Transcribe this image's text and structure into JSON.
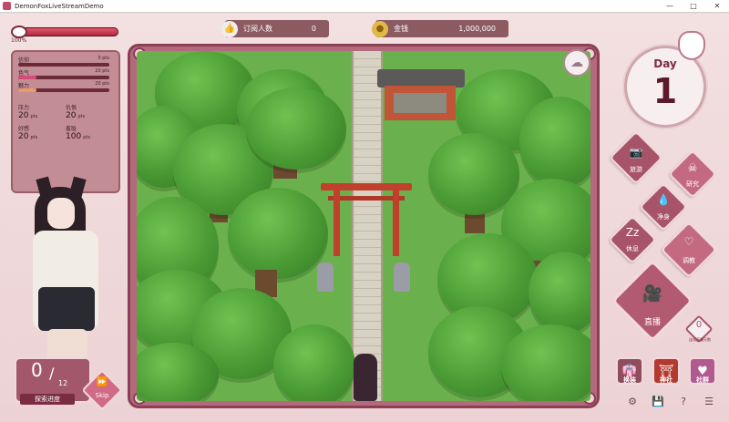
{
  "window": {
    "title": "DemonFoxLiveStreamDemo",
    "minimize_glyph": "—",
    "maximize_glyph": "□",
    "close_glyph": "✕"
  },
  "hud": {
    "hp_label": "100%",
    "hp_fraction": 1.0,
    "subscribers_label": "订阅人数",
    "subscribers_value": "0",
    "gold_label": "金钱",
    "gold_value": "1,000,000"
  },
  "stats": {
    "bars": [
      {
        "name": "信仰",
        "amount": "0",
        "unit": "pts",
        "fraction": 0.0
      },
      {
        "name": "色气",
        "amount": "20",
        "unit": "pts",
        "fraction": 0.2
      },
      {
        "name": "魅力",
        "amount": "20",
        "unit": "pts",
        "fraction": 0.2
      }
    ],
    "cells": [
      {
        "name": "压力",
        "value": "20",
        "unit": "pts"
      },
      {
        "name": "仇恨",
        "value": "20",
        "unit": "pts"
      },
      {
        "name": "好感",
        "value": "20",
        "unit": "pts"
      },
      {
        "name": "羞耻",
        "value": "100",
        "unit": "pts"
      }
    ]
  },
  "exploration": {
    "current": "0",
    "separator": "/",
    "total": "12",
    "label": "探索进度",
    "skip_label": "Skip",
    "skip_icon": "⏩"
  },
  "day": {
    "label": "Day",
    "number": "1"
  },
  "actions": [
    {
      "id": "travel",
      "label": "旅游",
      "icon": "camera-icon",
      "glyph": "📷"
    },
    {
      "id": "research",
      "label": "研究",
      "icon": "skull-icon",
      "glyph": "☠"
    },
    {
      "id": "purify",
      "label": "净身",
      "icon": "drop-icon",
      "glyph": "💧"
    },
    {
      "id": "rest",
      "label": "休息",
      "icon": "sleep-icon",
      "glyph": "Zz"
    },
    {
      "id": "train",
      "label": "调教",
      "icon": "heart-icon",
      "glyph": "♡"
    },
    {
      "id": "stream",
      "label": "直播",
      "icon": "video-camera-icon",
      "glyph": "🎥"
    }
  ],
  "stream_counter": {
    "value": "0",
    "label": "连续直播天数"
  },
  "bottom_buttons": [
    {
      "id": "change",
      "label": "换装",
      "glyph": "👘"
    },
    {
      "id": "shrine",
      "label": "神社",
      "glyph": "⛩"
    },
    {
      "id": "social",
      "label": "社群",
      "glyph": "♥"
    }
  ],
  "system_icons": [
    {
      "id": "settings",
      "glyph": "⚙"
    },
    {
      "id": "save",
      "glyph": "💾"
    },
    {
      "id": "help",
      "glyph": "?"
    },
    {
      "id": "menu",
      "glyph": "☰"
    }
  ],
  "colors": {
    "accent": "#a85468",
    "frame": "#8a3f55",
    "grass": "#6ab04c"
  }
}
